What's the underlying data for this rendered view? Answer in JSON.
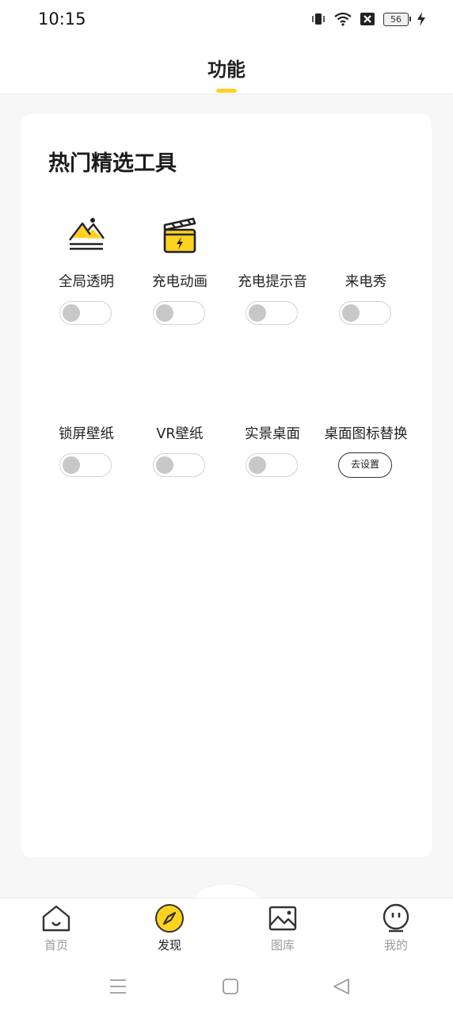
{
  "status_bar": {
    "time": "10:15",
    "battery": "56",
    "icons": [
      "vibrate-icon",
      "wifi-icon",
      "sim-blocked-icon",
      "battery-icon",
      "charging-icon"
    ]
  },
  "header": {
    "title": "功能"
  },
  "section": {
    "title": "热门精选工具",
    "tools": [
      {
        "label": "全局透明",
        "icon": "mountain-sun-icon",
        "control": "toggle",
        "on": false
      },
      {
        "label": "充电动画",
        "icon": "clapperboard-charge-icon",
        "control": "toggle",
        "on": false
      },
      {
        "label": "充电提示音",
        "control": "toggle",
        "on": false
      },
      {
        "label": "来电秀",
        "control": "toggle",
        "on": false
      },
      {
        "label": "锁屏壁纸",
        "control": "toggle",
        "on": false
      },
      {
        "label": "VR壁纸",
        "control": "toggle",
        "on": false
      },
      {
        "label": "实景桌面",
        "control": "toggle",
        "on": false
      },
      {
        "label": "桌面图标替换",
        "control": "button",
        "button_label": "去设置"
      }
    ]
  },
  "bottom_nav": {
    "items": [
      {
        "label": "首页",
        "icon": "home-icon",
        "active": false
      },
      {
        "label": "发现",
        "icon": "compass-icon",
        "active": true
      },
      {
        "label": "图库",
        "icon": "gallery-icon",
        "active": false
      },
      {
        "label": "我的",
        "icon": "profile-face-icon",
        "active": false
      }
    ]
  },
  "colors": {
    "accent": "#ffd21f",
    "toggle_off": "#c8c8c8",
    "text": "#222222",
    "inactive": "#9a9a9a"
  },
  "system_nav": {
    "buttons": [
      "menu-icon",
      "home-square-icon",
      "back-triangle-icon"
    ]
  }
}
